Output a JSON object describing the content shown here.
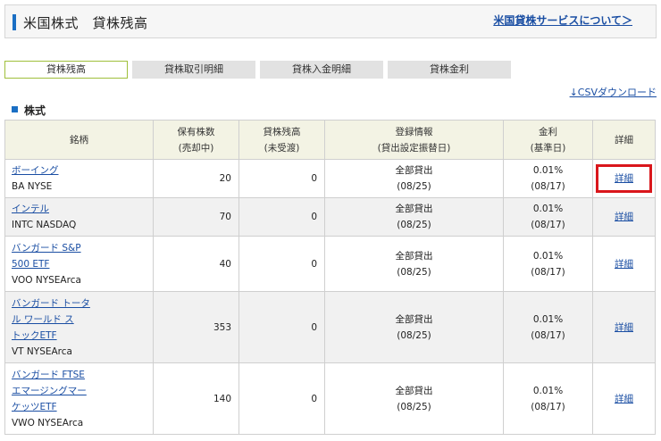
{
  "header": {
    "title": "米国株式　貸株残高",
    "about_link": "米国貸株サービスについて＞"
  },
  "tabs": [
    {
      "label": "貸株残高",
      "active": true
    },
    {
      "label": "貸株取引明細",
      "active": false
    },
    {
      "label": "貸株入金明細",
      "active": false
    },
    {
      "label": "貸株金利",
      "active": false
    }
  ],
  "csv_link": "↓CSVダウンロード",
  "section_title": "株式",
  "table": {
    "headers": {
      "name": "銘柄",
      "shares_line1": "保有株数",
      "shares_line2": "(売却中)",
      "loan_line1": "貸株残高",
      "loan_line2": "(未受渡)",
      "reg_line1": "登録情報",
      "reg_line2": "(貸出設定振替日)",
      "rate_line1": "金利",
      "rate_line2": "(基準日)",
      "detail": "詳細"
    },
    "rows": [
      {
        "name_lines": [
          "ボーイング"
        ],
        "market": "BA NYSE",
        "shares": "20",
        "loan": "0",
        "reg": "全部貸出",
        "reg_date": "(08/25)",
        "rate": "0.01%",
        "rate_date": "(08/17)",
        "detail": "詳細"
      },
      {
        "name_lines": [
          "インテル"
        ],
        "market": "INTC NASDAQ",
        "shares": "70",
        "loan": "0",
        "reg": "全部貸出",
        "reg_date": "(08/25)",
        "rate": "0.01%",
        "rate_date": "(08/17)",
        "detail": "詳細"
      },
      {
        "name_lines": [
          "バンガード S&P",
          "500 ETF"
        ],
        "market": "VOO NYSEArca",
        "shares": "40",
        "loan": "0",
        "reg": "全部貸出",
        "reg_date": "(08/25)",
        "rate": "0.01%",
        "rate_date": "(08/17)",
        "detail": "詳細"
      },
      {
        "name_lines": [
          "バンガード トータ",
          "ル ワールド ス",
          "トックETF"
        ],
        "market": "VT NYSEArca",
        "shares": "353",
        "loan": "0",
        "reg": "全部貸出",
        "reg_date": "(08/25)",
        "rate": "0.01%",
        "rate_date": "(08/17)",
        "detail": "詳細"
      },
      {
        "name_lines": [
          "バンガード FTSE",
          "エマージングマー",
          "ケッツETF"
        ],
        "market": "VWO NYSEArca",
        "shares": "140",
        "loan": "0",
        "reg": "全部貸出",
        "reg_date": "(08/25)",
        "rate": "0.01%",
        "rate_date": "(08/17)",
        "detail": "詳細"
      }
    ]
  },
  "colors": {
    "accent_blue": "#1a6fc4",
    "link_blue": "#1a4ea3",
    "active_tab_border": "#9fbf3a",
    "highlight_red": "#d9161b",
    "header_row_bg": "#f3f3e4"
  }
}
